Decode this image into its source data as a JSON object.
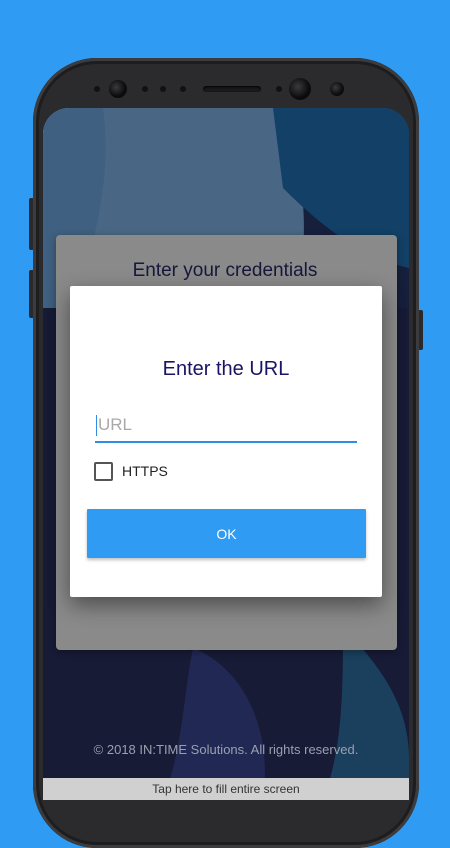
{
  "background": {
    "card_title": "Enter your credentials",
    "footer": "© 2018 IN:TIME Solutions. All rights reserved.",
    "fill_screen_bar": "Tap here to fill entire screen"
  },
  "dialog": {
    "title": "Enter the URL",
    "url_field": {
      "value": "",
      "placeholder": "URL"
    },
    "https_checkbox": {
      "label": "HTTPS",
      "checked": false
    },
    "ok_button": "OK"
  },
  "colors": {
    "accent": "#2f9bf2",
    "title_text": "#1a1466",
    "field_underline": "#2f8de4"
  }
}
